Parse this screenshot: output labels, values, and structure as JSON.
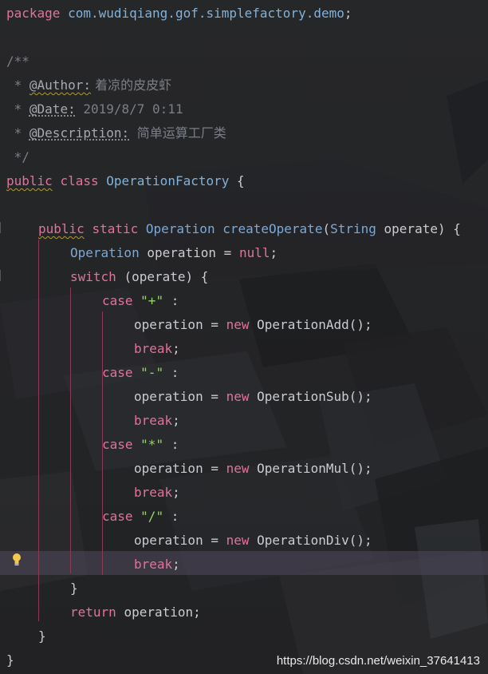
{
  "code": {
    "package_kw": "package",
    "package_name": "com.wudiqiang.gof.simplefactory.demo",
    "doc_open": "/**",
    "author_tag": "@Author:",
    "author_value": "着凉的皮皮虾",
    "date_tag": "@Date:",
    "date_value": "2019/8/7 0:11",
    "desc_tag": "@Description:",
    "desc_value": "简单运算工厂类",
    "doc_close": "*/",
    "class_mod": "public",
    "class_kw": "class",
    "class_name": "OperationFactory",
    "method_mod": "public",
    "method_static": "static",
    "return_type": "Operation",
    "method_name": "createOperate",
    "param_type": "String",
    "param_name": "operate",
    "var_type": "Operation",
    "var_name": "operation",
    "null_kw": "null",
    "switch_kw": "switch",
    "switch_arg": "(operate)",
    "case_kw": "case",
    "new_kw": "new",
    "break_kw": "break",
    "return_kw": "return",
    "cases": [
      {
        "op": "\"+\"",
        "cls": "OperationAdd"
      },
      {
        "op": "\"-\"",
        "cls": "OperationSub"
      },
      {
        "op": "\"*\"",
        "cls": "OperationMul"
      },
      {
        "op": "\"/\"",
        "cls": "OperationDiv"
      }
    ]
  },
  "watermark": "https://blog.csdn.net/weixin_37641413",
  "colors": {
    "keyword": "#e2729b",
    "type": "#79a9d6",
    "string": "#9ad36a",
    "comment": "#7b7e86",
    "text": "#c9ccd1",
    "current_line": "#3f3a48"
  }
}
